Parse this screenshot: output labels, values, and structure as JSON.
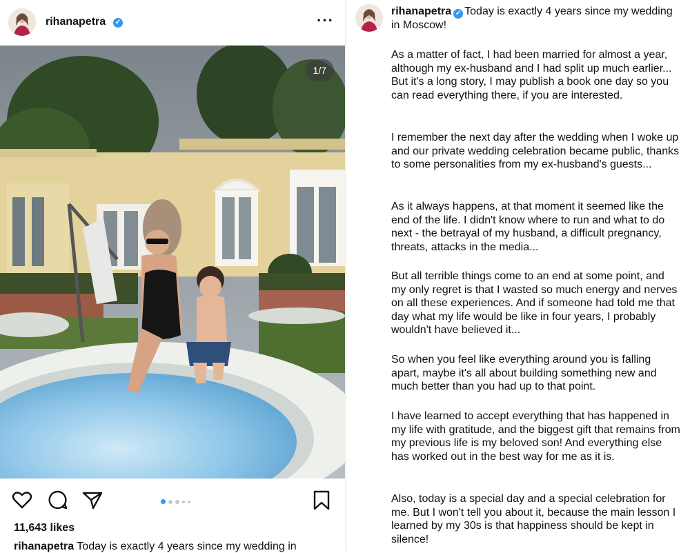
{
  "post": {
    "username": "rihanapetra",
    "verified_icon": "verified-badge-icon",
    "more_icon": "more-options-icon",
    "slide_counter": "1/7",
    "carousel": {
      "current": 1,
      "visible_dots": 5
    },
    "actions": [
      "like-icon",
      "comment-icon",
      "share-icon",
      "save-icon"
    ],
    "likes": "11,643 likes",
    "caption_preview": "Today is exactly 4 years since my wedding in"
  },
  "caption_panel": {
    "username": "rihanapetra",
    "title": "Today is exactly 4 years since my wedding in Moscow!",
    "paragraphs": [
      "As a matter of fact, I had been married for almost a year, although my ex-husband and I had split up much earlier... But it's a long story, I may publish a book one day so you can read everything there, if you are interested.",
      "I remember the next day after the wedding when I woke up and our private wedding celebration became public, thanks to some personalities from my ex-husband's guests...",
      "As it always happens, at that moment it seemed like the end of the life. I didn't know where to run and what to do next - the betrayal of my husband, a difficult pregnancy, threats, attacks in the media...",
      "But all terrible things come to an end at some point, and my only regret is that I wasted so much energy and nerves on all these experiences. And if someone had told me that day what my life would be like in four years, I probably wouldn't have believed it...",
      "So when you feel like everything around you is falling apart, maybe it's all about building something new and much better than you had up to that point.",
      "I have learned to accept everything that has happened in my life with gratitude, and the biggest gift that remains from my previous life is my beloved son! And everything else has worked out in the best way for me as it is.",
      "Also, today is a special day and a special celebration for me. But I won't tell you about it, because the main lesson I learned by my 30s is that happiness should be kept in silence!"
    ]
  },
  "colors": {
    "accent_blue": "#3797f0",
    "text": "#111111",
    "pool_water": "#8fc6e8"
  }
}
